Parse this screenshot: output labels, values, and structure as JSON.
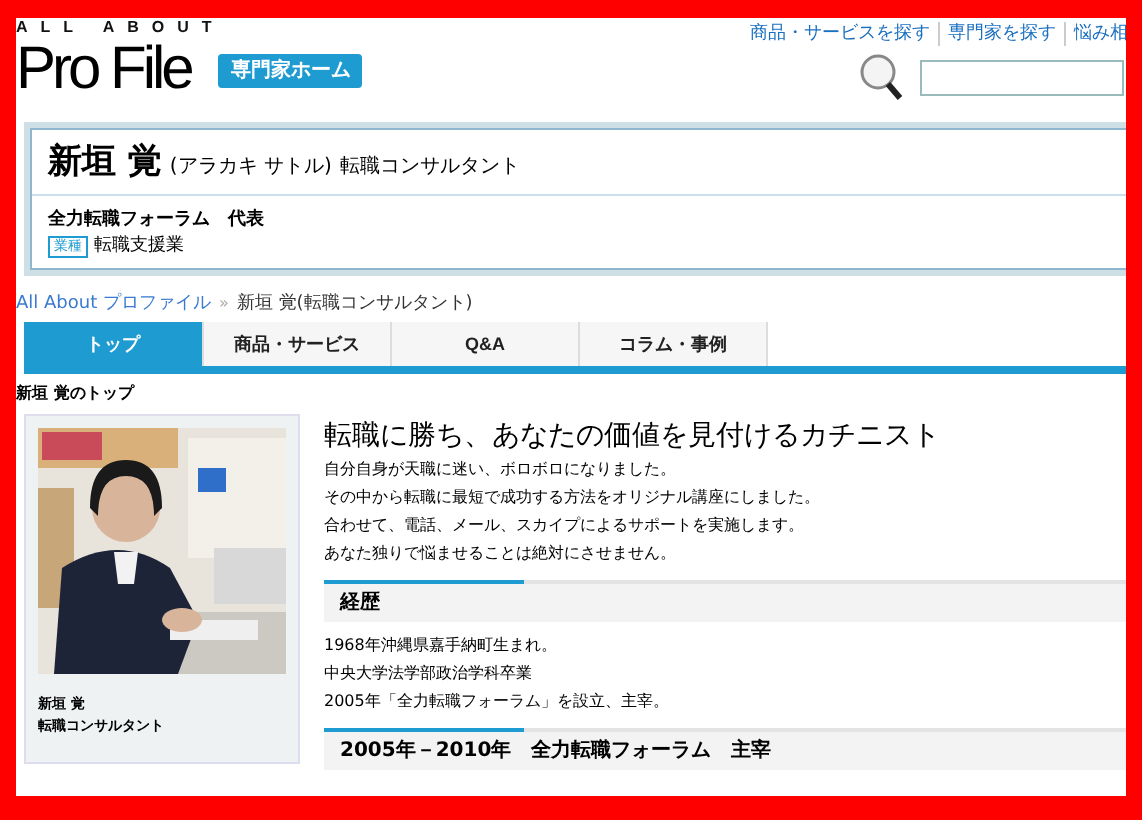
{
  "brand": {
    "tagline": "ALL ABOUT",
    "logo": "Pro File",
    "home_button": "専門家ホーム"
  },
  "top_links": [
    "商品・サービスを探す",
    "専門家を探す",
    "悩み相"
  ],
  "profile": {
    "name": "新垣 覚",
    "reading": "(アラカキ サトル)",
    "title": "転職コンサルタント",
    "organization": "全力転職フォーラム　代表",
    "industry_tag": "業種",
    "industry": "転職支援業"
  },
  "breadcrumb": {
    "separator": "»",
    "items": [
      {
        "label": "All About プロファイル",
        "link": true
      },
      {
        "label": "新垣 覚(転職コンサルタント)",
        "link": false
      }
    ]
  },
  "tabs": [
    {
      "label": "トップ",
      "selected": true
    },
    {
      "label": "商品・サービス",
      "selected": false
    },
    {
      "label": "Q&A",
      "selected": false
    },
    {
      "label": "コラム・事例",
      "selected": false
    }
  ],
  "page_heading": "新垣 覚のトップ",
  "sidebar": {
    "name": "新垣 覚",
    "title": "転職コンサルタント"
  },
  "headline": "転職に勝ち、あなたの価値を見付けるカチニスト",
  "intro": [
    "自分自身が天職に迷い、ボロボロになりました。",
    "その中から転職に最短で成功する方法をオリジナル講座にしました。",
    "合わせて、電話、メール、スカイプによるサポートを実施します。",
    "あなた独りで悩ませることは絶対にさせません。"
  ],
  "sections": [
    {
      "heading": "経歴",
      "lines": [
        "1968年沖縄県嘉手納町生まれ。",
        "中央大学法学部政治学科卒業",
        "2005年「全力転職フォーラム」を設立、主宰。"
      ]
    },
    {
      "heading": "2005年－2010年　全力転職フォーラム　主宰"
    }
  ]
}
